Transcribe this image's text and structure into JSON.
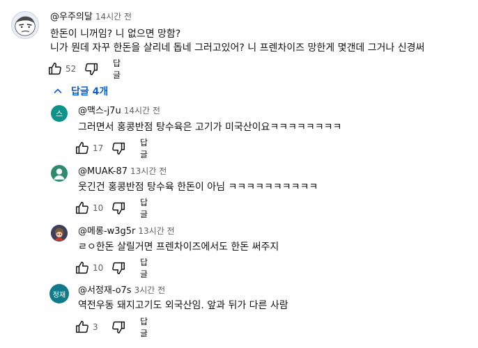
{
  "thread": {
    "comment": {
      "author": "@우주의달",
      "time": "14시간 전",
      "lines": [
        "한돈이 니꺼임? 니 없으면 망함?",
        "니가 뭔데 자꾸 한돈을 살리네 돕네 그러고있어? 니 프렌차이즈 망한게 몇갠데 그거나 신경써"
      ],
      "likes": "52",
      "reply_label": "답글"
    },
    "replies_toggle_label": "답글 4개",
    "replies": [
      {
        "avatar_text": "스",
        "avatar_color": "#0d9488",
        "author": "@맥스-j7u",
        "time": "14시간 전",
        "text": "그러면서 홍콩반점 탕수육은 고기가 미국산이요ㅋㅋㅋㅋㅋㅋㅋㅋ",
        "likes": "17",
        "reply_label": "답글"
      },
      {
        "avatar_text": "",
        "avatar_color": "#2e8b6e",
        "author": "@MUAK-87",
        "time": "13시간 전",
        "text": "웃긴건 홍콩반점 탕수육 한돈이 아님 ㅋㅋㅋㅋㅋㅋㅋㅋㅋㅋ",
        "likes": "10",
        "reply_label": "답글"
      },
      {
        "avatar_text": "",
        "avatar_color": "#4a4a6a",
        "author": "@메롱-w3g5r",
        "time": "13시간 전",
        "text": "ㄹㅇ한돈 살릴거면 프렌차이즈에서도 한돈 써주지",
        "likes": "10",
        "reply_label": "답글"
      },
      {
        "avatar_text": "정재",
        "avatar_color": "#0f7a8a",
        "author": "@서정재-o7s",
        "time": "3시간 전",
        "text": "역전우동 돼지고기도 외국산임. 앞과 뒤가 다른 사람",
        "likes": "3",
        "reply_label": "답글"
      }
    ]
  },
  "icons": {
    "like": "thumbs-up-icon",
    "dislike": "thumbs-down-icon",
    "collapse": "chevron-up-icon",
    "person": "person-icon"
  },
  "colors": {
    "link_blue": "#065fd4",
    "secondary_text": "#606060",
    "primary_text": "#0f0f0f"
  }
}
